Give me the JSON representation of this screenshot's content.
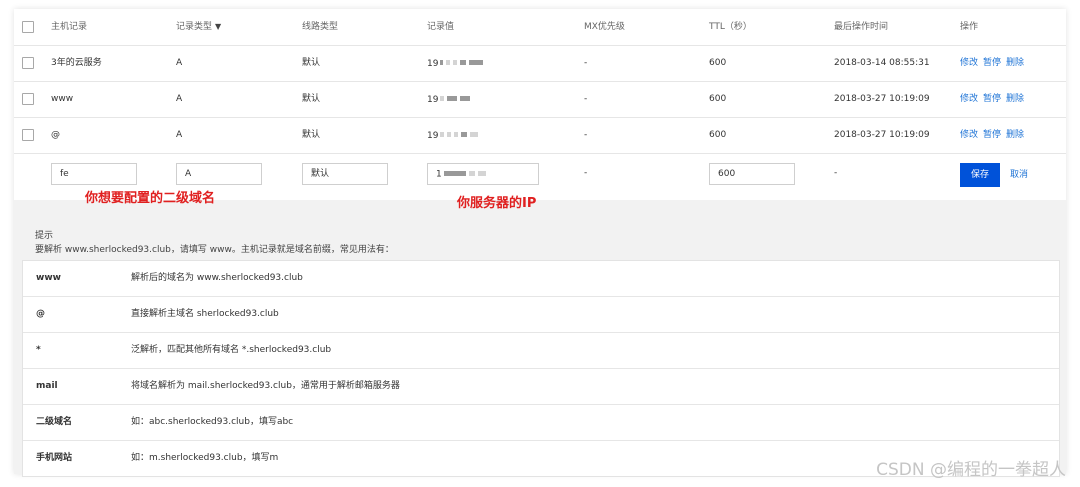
{
  "table": {
    "headers": [
      "主机记录",
      "记录类型",
      "线路类型",
      "记录值",
      "MX优先级",
      "TTL（秒）",
      "最后操作时间",
      "操作"
    ],
    "rows": [
      {
        "host": "3年的云服务",
        "type": "A",
        "line": "默认",
        "value": "19",
        "mx": "-",
        "ttl": "600",
        "time": "2018-03-14 08:55:31"
      },
      {
        "host": "www",
        "type": "A",
        "line": "默认",
        "value": "19",
        "mx": "-",
        "ttl": "600",
        "time": "2018-03-27 10:19:09"
      },
      {
        "host": "@",
        "type": "A",
        "line": "默认",
        "value": "19",
        "mx": "-",
        "ttl": "600",
        "time": "2018-03-27 10:19:09"
      }
    ],
    "actions": {
      "edit": "修改",
      "pause": "暂停",
      "delete": "删除"
    }
  },
  "edit_row": {
    "host": "fe",
    "type": "A",
    "line": "默认",
    "value": "1",
    "mx": "-",
    "ttl": "600",
    "time": "-",
    "save": "保存",
    "cancel": "取消"
  },
  "annotations": {
    "subdomain": "你想要配置的二级域名",
    "ip": "你服务器的IP",
    "color": "#e02020"
  },
  "tips": {
    "title": "提示",
    "desc": "要解析 www.sherlocked93.club，请填写 www。主机记录就是域名前缀，常见用法有：",
    "rows": [
      {
        "key": "www",
        "val": "解析后的域名为 www.sherlocked93.club"
      },
      {
        "key": "@",
        "val": "直接解析主域名 sherlocked93.club"
      },
      {
        "key": "*",
        "val": "泛解析，匹配其他所有域名 *.sherlocked93.club"
      },
      {
        "key": "mail",
        "val": "将域名解析为 mail.sherlocked93.club，通常用于解析邮箱服务器"
      },
      {
        "key": "二级域名",
        "val": "如：abc.sherlocked93.club，填写abc"
      },
      {
        "key": "手机网站",
        "val": "如：m.sherlocked93.club，填写m"
      }
    ]
  },
  "watermark": "CSDN @编程的一拳超人",
  "colors": {
    "link": "#1f74d6",
    "primary_button": "#0052d9"
  }
}
